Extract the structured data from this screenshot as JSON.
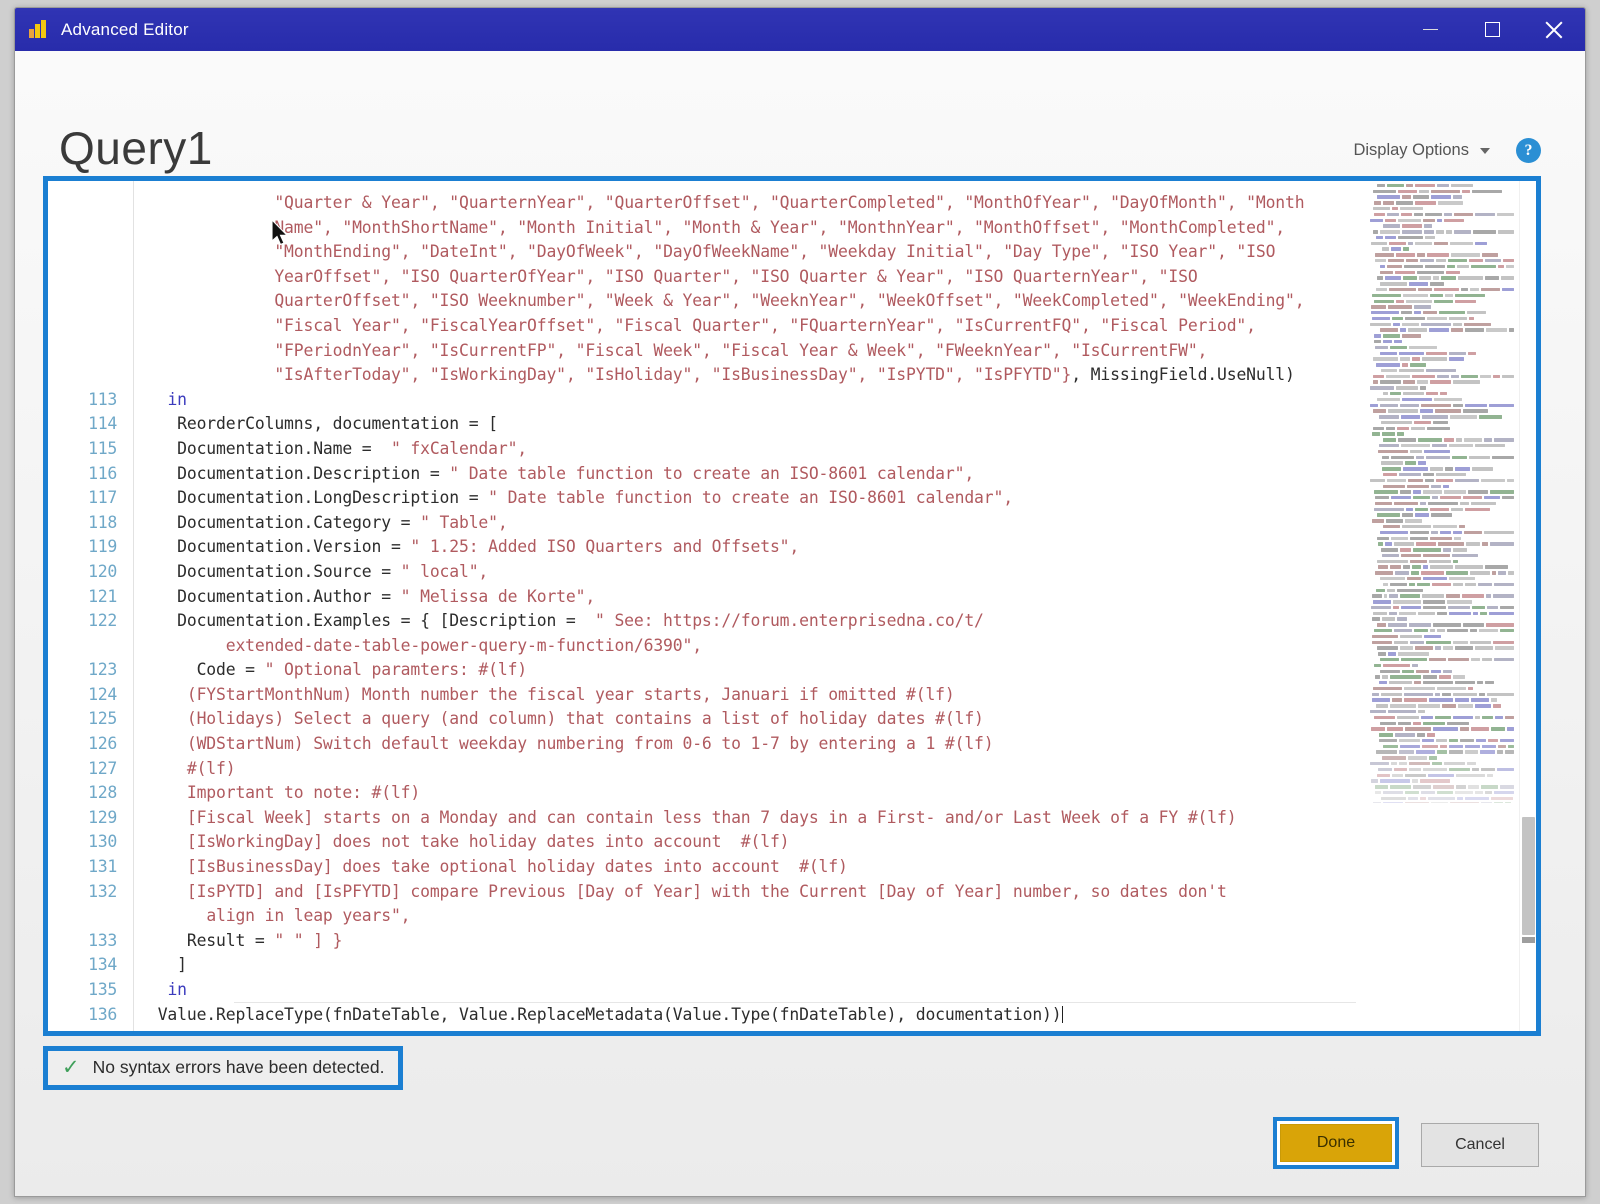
{
  "window": {
    "title": "Advanced Editor",
    "icon": "power-bi-icon",
    "minimize_label": "Minimize",
    "maximize_label": "Maximize",
    "close_label": "Close"
  },
  "header": {
    "query_title": "Query1",
    "display_options_label": "Display Options",
    "help_label": "?"
  },
  "editor": {
    "first_line_number": 113,
    "last_line_number": 136,
    "lines": [
      {
        "num": "",
        "indent": 13,
        "text": "\"Quarter & Year\", \"QuarternYear\", \"QuarterOffset\", \"QuarterCompleted\", \"MonthOfYear\", \"DayOfMonth\", \"Month",
        "kind": "string"
      },
      {
        "num": "",
        "indent": 13,
        "text": "Name\", \"MonthShortName\", \"Month Initial\", \"Month & Year\", \"MonthnYear\", \"MonthOffset\", \"MonthCompleted\",",
        "kind": "string"
      },
      {
        "num": "",
        "indent": 13,
        "text": "\"MonthEnding\", \"DateInt\", \"DayOfWeek\", \"DayOfWeekName\", \"Weekday Initial\", \"Day Type\", \"ISO Year\", \"ISO",
        "kind": "string"
      },
      {
        "num": "",
        "indent": 13,
        "text": "YearOffset\", \"ISO QuarterOfYear\", \"ISO Quarter\", \"ISO Quarter & Year\", \"ISO QuarternYear\", \"ISO",
        "kind": "string"
      },
      {
        "num": "",
        "indent": 13,
        "text": "QuarterOffset\", \"ISO Weeknumber\", \"Week & Year\", \"WeeknYear\", \"WeekOffset\", \"WeekCompleted\", \"WeekEnding\",",
        "kind": "string"
      },
      {
        "num": "",
        "indent": 13,
        "text": "\"Fiscal Year\", \"FiscalYearOffset\", \"Fiscal Quarter\", \"FQuarternYear\", \"IsCurrentFQ\", \"Fiscal Period\",",
        "kind": "string"
      },
      {
        "num": "",
        "indent": 13,
        "text": "\"FPeriodnYear\", \"IsCurrentFP\", \"Fiscal Week\", \"Fiscal Year & Week\", \"FWeeknYear\", \"IsCurrentFW\",",
        "kind": "string"
      },
      {
        "num": "",
        "indent": 13,
        "text": "\"IsAfterToday\", \"IsWorkingDay\", \"IsHoliday\", \"IsBusinessDay\", \"IsPYTD\", \"IsPFYTD\"}, MissingField.UseNull)",
        "kind": "string-tail"
      },
      {
        "num": "113",
        "indent": 2,
        "text": "in",
        "kind": "keyword"
      },
      {
        "num": "114",
        "indent": 3,
        "text": "ReorderColumns, documentation = [",
        "kind": "code"
      },
      {
        "num": "115",
        "indent": 3,
        "text": "Documentation.Name =  \" fxCalendar\",",
        "kind": "mixed",
        "split": 20
      },
      {
        "num": "116",
        "indent": 3,
        "text": "Documentation.Description = \" Date table function to create an ISO-8601 calendar\",",
        "kind": "mixed",
        "split": 28
      },
      {
        "num": "117",
        "indent": 3,
        "text": "Documentation.LongDescription = \" Date table function to create an ISO-8601 calendar\",",
        "kind": "mixed",
        "split": 32
      },
      {
        "num": "118",
        "indent": 3,
        "text": "Documentation.Category = \" Table\",",
        "kind": "mixed",
        "split": 25
      },
      {
        "num": "119",
        "indent": 3,
        "text": "Documentation.Version = \" 1.25: Added ISO Quarters and Offsets\",",
        "kind": "mixed",
        "split": 24
      },
      {
        "num": "120",
        "indent": 3,
        "text": "Documentation.Source = \" local\",",
        "kind": "mixed",
        "split": 23
      },
      {
        "num": "121",
        "indent": 3,
        "text": "Documentation.Author = \" Melissa de Korte\",",
        "kind": "mixed",
        "split": 23
      },
      {
        "num": "122",
        "indent": 3,
        "text": "Documentation.Examples = { [Description =  \" See: https://forum.enterprisedna.co/t/",
        "kind": "mixed",
        "split": 42
      },
      {
        "num": "",
        "indent": 8,
        "text": "extended-date-table-power-query-m-function/6390\",",
        "kind": "string"
      },
      {
        "num": "123",
        "indent": 5,
        "text": "Code = \" Optional paramters: #(lf)",
        "kind": "mixed",
        "split": 7
      },
      {
        "num": "124",
        "indent": 4,
        "text": "(FYStartMonthNum) Month number the fiscal year starts, Januari if omitted #(lf)",
        "kind": "string"
      },
      {
        "num": "125",
        "indent": 4,
        "text": "(Holidays) Select a query (and column) that contains a list of holiday dates #(lf)",
        "kind": "string"
      },
      {
        "num": "126",
        "indent": 4,
        "text": "(WDStartNum) Switch default weekday numbering from 0-6 to 1-7 by entering a 1 #(lf)",
        "kind": "string"
      },
      {
        "num": "127",
        "indent": 4,
        "text": "#(lf)",
        "kind": "string"
      },
      {
        "num": "128",
        "indent": 4,
        "text": "Important to note: #(lf)",
        "kind": "string"
      },
      {
        "num": "129",
        "indent": 4,
        "text": "[Fiscal Week] starts on a Monday and can contain less than 7 days in a First- and/or Last Week of a FY #(lf)",
        "kind": "string"
      },
      {
        "num": "130",
        "indent": 4,
        "text": "[IsWorkingDay] does not take holiday dates into account  #(lf)",
        "kind": "string"
      },
      {
        "num": "131",
        "indent": 4,
        "text": "[IsBusinessDay] does take optional holiday dates into account  #(lf)",
        "kind": "string"
      },
      {
        "num": "132",
        "indent": 4,
        "text": "[IsPYTD] and [IsPFYTD] compare Previous [Day of Year] with the Current [Day of Year] number, so dates don't",
        "kind": "string"
      },
      {
        "num": "",
        "indent": 6,
        "text": "align in leap years\",",
        "kind": "string"
      },
      {
        "num": "133",
        "indent": 4,
        "text": "Result = \" \" ] }",
        "kind": "mixed",
        "split": 9
      },
      {
        "num": "134",
        "indent": 3,
        "text": "]",
        "kind": "code"
      },
      {
        "num": "135",
        "indent": 2,
        "text": "in",
        "kind": "keyword"
      },
      {
        "num": "136",
        "indent": 1,
        "text": "Value.ReplaceType(fnDateTable, Value.ReplaceMetadata(Value.Type(fnDateTable), documentation))",
        "kind": "code",
        "caret": true
      }
    ]
  },
  "status": {
    "icon": "check-icon",
    "message": "No syntax errors have been detected."
  },
  "footer": {
    "done_label": "Done",
    "cancel_label": "Cancel"
  },
  "colors": {
    "titlebar": "#2c2fa8",
    "annotation_blue": "#1b7fd2",
    "done_button": "#d9a408",
    "string_red": "#b05a5f",
    "keyword_blue": "#3b3bbd",
    "line_number": "#6fa8c8",
    "check_green": "#3f9f5a",
    "help_blue": "#2b8fd4"
  }
}
